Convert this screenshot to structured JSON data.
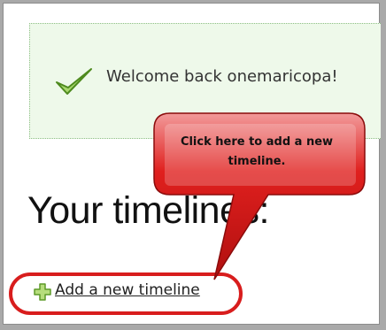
{
  "welcome": {
    "message": "Welcome back onemaricopa!",
    "icon": "checkmark-icon"
  },
  "callout": {
    "text": "Click here to add a new timeline.",
    "color": "#e0201e"
  },
  "timelines": {
    "heading": "Your timelines:",
    "add_link_label": "Add a new timeline",
    "add_icon": "plus-icon"
  },
  "colors": {
    "highlight": "#d81d1d",
    "welcome_bg": "#eef9ea",
    "check": "#8cc63f"
  }
}
